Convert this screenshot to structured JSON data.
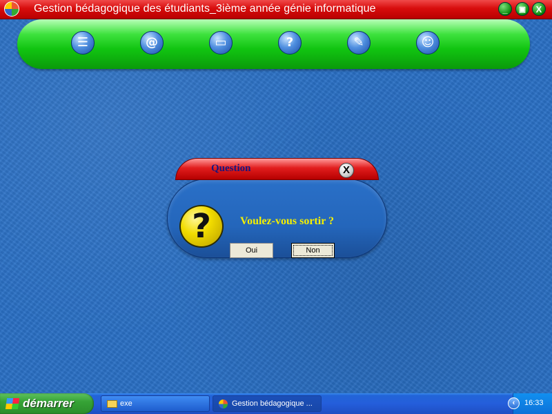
{
  "window": {
    "title": "Gestion bédagogique des étudiants_3ième année génie informatique",
    "controls": {
      "minimize": "_",
      "restore": "▣",
      "close": "X"
    }
  },
  "toolbar": {
    "icons": [
      "students-icon",
      "search-icon",
      "computer-icon",
      "help-icon",
      "tools-icon",
      "users-icon"
    ]
  },
  "dialog": {
    "title": "Question",
    "close_label": "X",
    "message": "Voulez-vous sortir ?",
    "icon_glyph": "?",
    "buttons": {
      "yes": "Oui",
      "no": "Non"
    }
  },
  "taskbar": {
    "start_label": "démarrer",
    "tasks": [
      {
        "label": "exe"
      },
      {
        "label": "Gestion bédagogique ..."
      }
    ],
    "clock": "16:33"
  }
}
